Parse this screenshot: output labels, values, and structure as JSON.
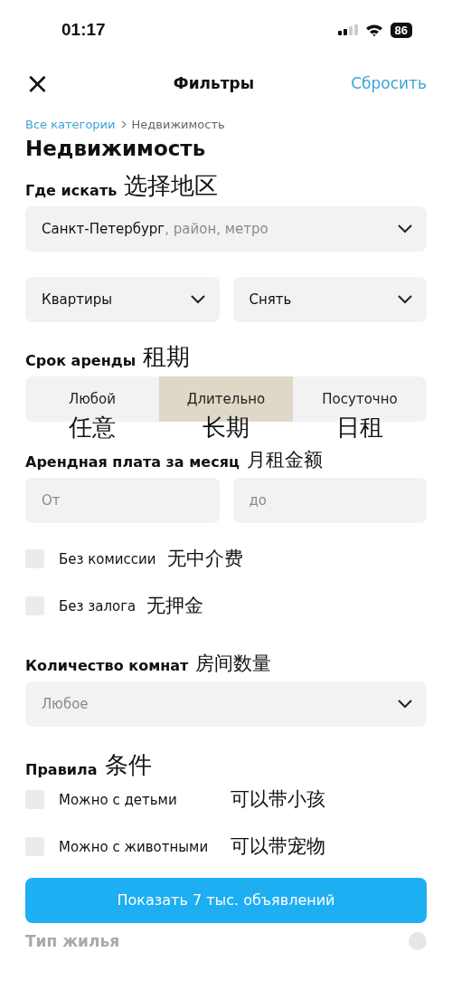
{
  "status_bar": {
    "time": "01:17",
    "battery": "86"
  },
  "header": {
    "close": "×",
    "title": "Фильтры",
    "reset": "Сбросить"
  },
  "breadcrumb": [
    {
      "label": "Все категории",
      "kind": "link"
    },
    {
      "label": "Недвижимость",
      "kind": "current"
    }
  ],
  "page_title": "Недвижимость",
  "location": {
    "label": "Где искать",
    "note": "选择地区",
    "value": "Санкт-Петербург",
    "placeholder": ", район, метро"
  },
  "selects": [
    {
      "value": "Квартиры"
    },
    {
      "value": "Снять"
    }
  ],
  "rent_term": {
    "label": "Срок аренды",
    "note": "租期",
    "options": [
      {
        "label": "Любой",
        "note": "任意",
        "selected": false
      },
      {
        "label": "Длительно",
        "note": "长期",
        "selected": true
      },
      {
        "label": "Посуточно",
        "note": "日租",
        "selected": false
      }
    ]
  },
  "price": {
    "label": "Арендная плата за месяц",
    "note": "月租金额",
    "from_placeholder": "От",
    "to_placeholder": "до"
  },
  "options": [
    {
      "label": "Без комиссии",
      "note": "无中介费",
      "checked": false
    },
    {
      "label": "Без залога",
      "note": "无押金",
      "checked": false
    }
  ],
  "rooms": {
    "label": "Количество комнат",
    "note": "房间数量",
    "placeholder": "Любое"
  },
  "rules": {
    "label": "Правила",
    "note": "条件",
    "items": [
      {
        "label": "Можно с детьми",
        "note": "可以带小孩",
        "checked": false
      },
      {
        "label": "Можно с животными",
        "note": "可以带宠物",
        "checked": false
      }
    ]
  },
  "show_button": "Показать 7 тыс. объявлений",
  "next_section": "Тип жилья"
}
